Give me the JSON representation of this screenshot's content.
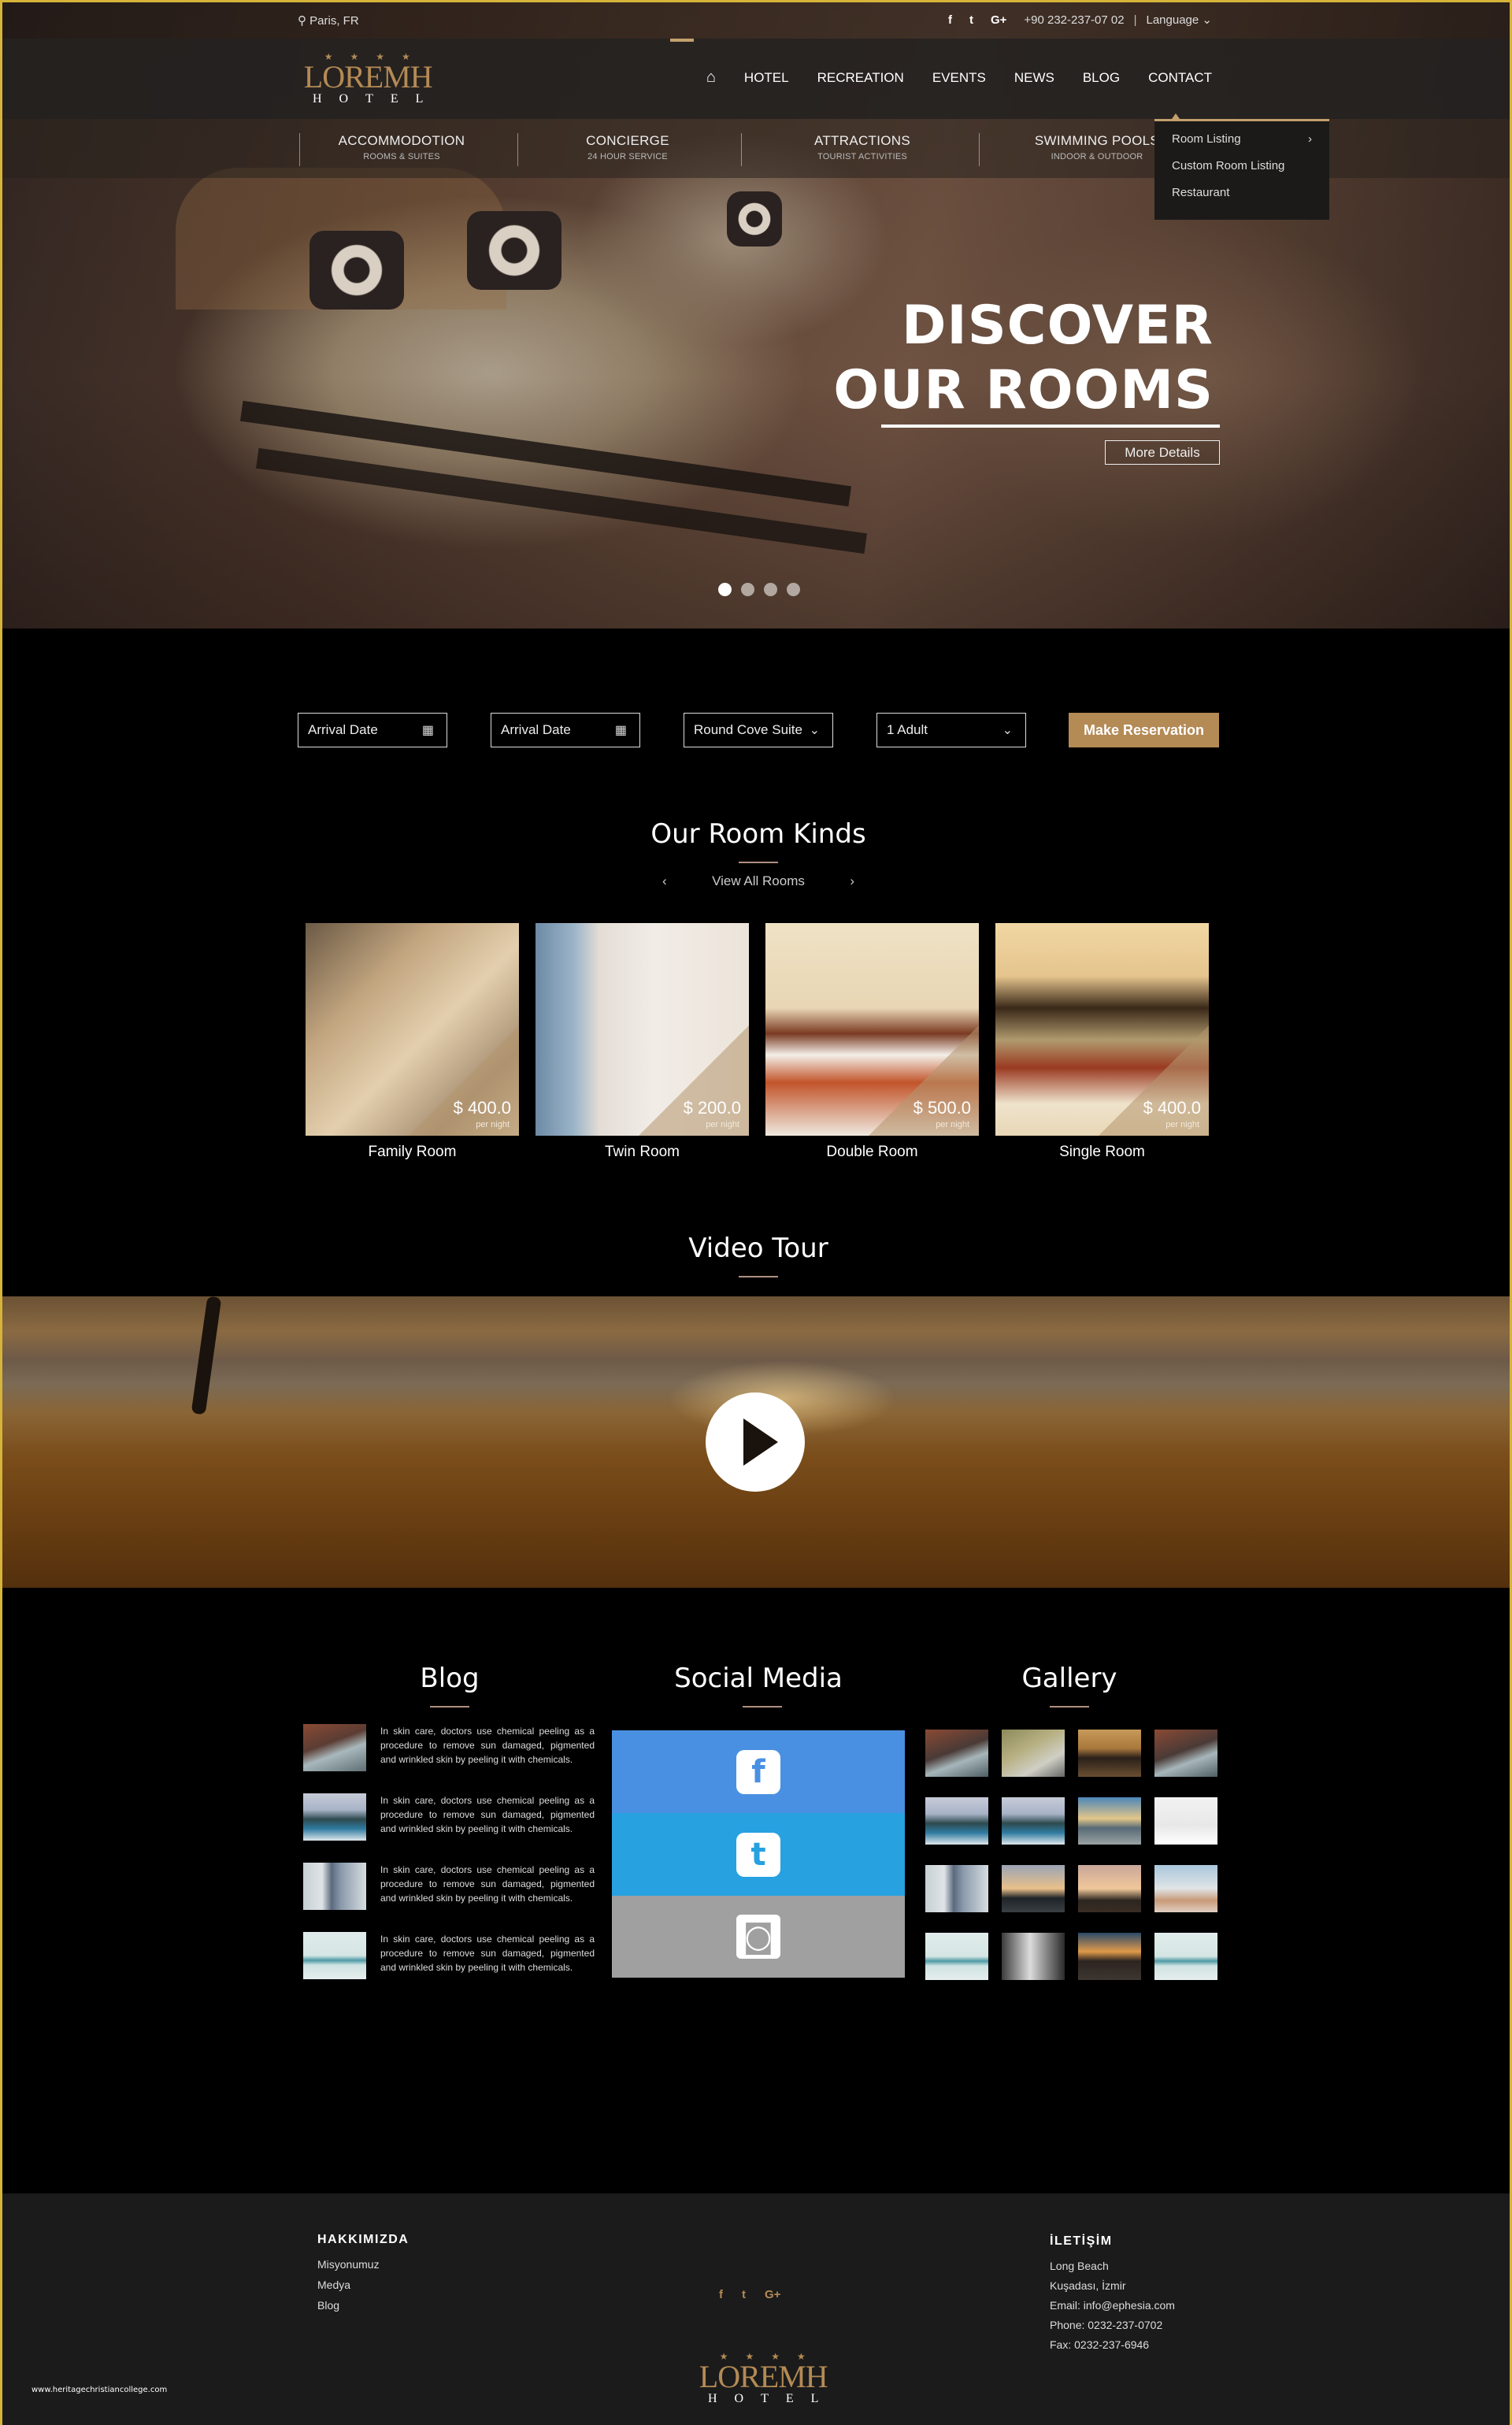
{
  "topbar": {
    "location": "Paris, FR",
    "social": [
      "f",
      "t",
      "G+"
    ],
    "phone": "+90 232-237-07 02",
    "separator": "|",
    "language": "Language"
  },
  "logo": {
    "stars": "★★★★",
    "brand": "LOREMH",
    "sub": "HOTEL"
  },
  "nav": {
    "home_icon": "home-icon",
    "items": [
      "HOTEL",
      "RECREATION",
      "EVENTS",
      "NEWS",
      "BLOG",
      "CONTACT"
    ]
  },
  "subnav": [
    {
      "title": "ACCOMMODOTION",
      "sub": "ROOMS & SUITES"
    },
    {
      "title": "CONCIERGE",
      "sub": "24 HOUR SERVICE"
    },
    {
      "title": "ATTRACTIONS",
      "sub": "TOURIST ACTIVITIES"
    },
    {
      "title": "SWIMMING POOLS",
      "sub": "INDOOR & OUTDOOR"
    }
  ],
  "dropdown": {
    "items": [
      "Room Listing",
      "Custom Room Listing",
      "Restaurant"
    ],
    "submenu_arrow": "›"
  },
  "hero": {
    "title_line1": "DISCOVER",
    "title_line2": "OUR ROOMS",
    "button": "More Details",
    "slides_total": 4,
    "active_slide": 1
  },
  "booking": {
    "arrival1": "Arrival Date",
    "arrival2": "Arrival Date",
    "room_type": "Round Cove Suite",
    "guests": "1 Adult",
    "button": "Make Reservation",
    "accent": "#b48a55"
  },
  "rooms_section": {
    "title": "Our Room Kinds",
    "view_all": "View All Rooms",
    "prev": "‹",
    "next": "›",
    "rooms": [
      {
        "name": "Family Room",
        "price": "$ 400.0",
        "per": "per night"
      },
      {
        "name": "Twin Room",
        "price": "$ 200.0",
        "per": "per night"
      },
      {
        "name": "Double Room",
        "price": "$ 500.0",
        "per": "per night"
      },
      {
        "name": "Single Room",
        "price": "$ 400.0",
        "per": "per night"
      }
    ]
  },
  "video": {
    "title": "Video Tour"
  },
  "blog": {
    "title": "Blog",
    "posts": [
      {
        "text": "In skin care, doctors use chemical peeling as a procedure to remove sun damaged, pigmented and wrinkled skin by peeling it with chemicals."
      },
      {
        "text": "In skin care, doctors use chemical peeling as a procedure to remove sun damaged, pigmented and wrinkled skin by peeling it with chemicals."
      },
      {
        "text": "In skin care, doctors use chemical peeling as a procedure to remove sun damaged, pigmented and wrinkled skin by peeling it with chemicals."
      },
      {
        "text": "In skin care, doctors use chemical peeling as a procedure to remove sun damaged, pigmented and wrinkled skin by peeling it with chemicals."
      }
    ]
  },
  "social_media": {
    "title": "Social Media",
    "networks": [
      {
        "name": "facebook",
        "glyph": "f",
        "color": "#4a90e2"
      },
      {
        "name": "twitter",
        "glyph": "t",
        "color": "#27a1e0"
      },
      {
        "name": "instagram",
        "glyph": "◙",
        "color": "#a0a0a0"
      }
    ]
  },
  "gallery": {
    "title": "Gallery",
    "count": 16
  },
  "footer": {
    "about_title": "HAKKIMIZDA",
    "about_links": [
      "Misyonumuz",
      "Medya",
      "Blog"
    ],
    "social": [
      "f",
      "t",
      "G+"
    ],
    "contact_title": "İLETİŞİM",
    "contact_lines": [
      "Long Beach",
      "Kuşadası, İzmir",
      "Email: info@ephesia.com",
      "Phone:  0232-237-0702",
      "Fax:  0232-237-6946"
    ],
    "credit": "www.heritagechristiancollege.com"
  }
}
